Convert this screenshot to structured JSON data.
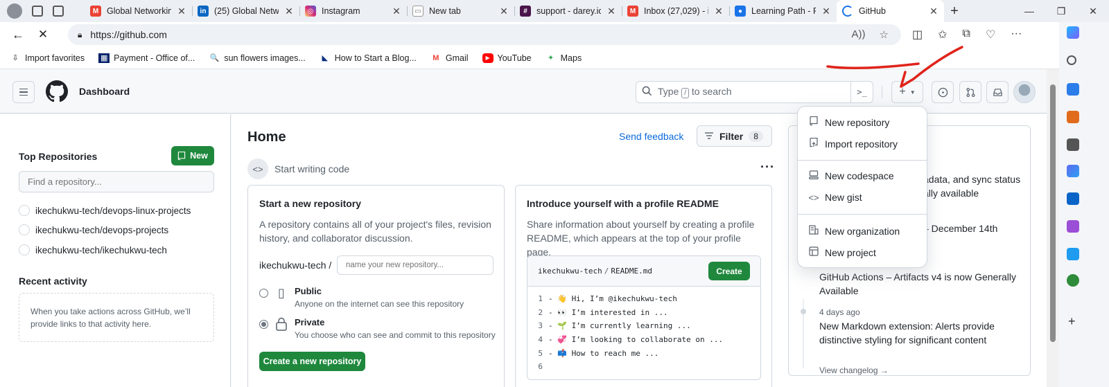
{
  "browser": {
    "tabs": [
      {
        "title": "Global Networkin",
        "fav": "M",
        "color": "#ea4335"
      },
      {
        "title": "(25) Global Netw",
        "fav": "in",
        "color": "#0a66c2"
      },
      {
        "title": "Instagram",
        "fav": "◎",
        "color": "#d6249f"
      },
      {
        "title": "New tab",
        "fav": "▭",
        "color": "#9aa0a6"
      },
      {
        "title": "support - darey.io",
        "fav": "#",
        "color": "#4a154b"
      },
      {
        "title": "Inbox (27,029) - i",
        "fav": "M",
        "color": "#ea4335"
      },
      {
        "title": "Learning Path - P",
        "fav": "●",
        "color": "#1a73e8"
      },
      {
        "title": "GitHub",
        "fav": "◐",
        "color": "#24292f"
      }
    ],
    "url": "https://github.com",
    "bookmarks": [
      {
        "label": "Import favorites",
        "icon": "⇩"
      },
      {
        "label": "Payment - Office of...",
        "icon": "▦"
      },
      {
        "label": "sun flowers images...",
        "icon": "🔍"
      },
      {
        "label": "How to Start a Blog...",
        "icon": "◣"
      },
      {
        "label": "Gmail",
        "icon": "M"
      },
      {
        "label": "YouTube",
        "icon": "▶"
      },
      {
        "label": "Maps",
        "icon": "✦"
      }
    ]
  },
  "header": {
    "title": "Dashboard",
    "search_type": "Type",
    "search_key": "/",
    "search_rest": "to search"
  },
  "sidebar": {
    "top_repositories": "Top Repositories",
    "new_button": "New",
    "find_placeholder": "Find a repository...",
    "repos": [
      "ikechukwu-tech/devops-linux-projects",
      "ikechukwu-tech/devops-projects",
      "ikechukwu-tech/ikechukwu-tech"
    ],
    "recent_activity": "Recent activity",
    "recent_empty_line1": "When you take actions across GitHub, we’ll",
    "recent_empty_line2": "provide links to that activity here."
  },
  "main": {
    "home": "Home",
    "send_feedback": "Send feedback",
    "filter": "Filter",
    "filter_count": "8",
    "start_writing": "Start writing code",
    "new_repo_card": {
      "title": "Start a new repository",
      "description": "A repository contains all of your project's files, revision history, and collaborator discussion.",
      "owner": "ikechukwu-tech /",
      "name_placeholder": "name your new repository...",
      "public_title": "Public",
      "public_desc": "Anyone on the internet can see this repository",
      "private_title": "Private",
      "private_desc": "You choose who can see and commit to this repository",
      "create_button": "Create a new repository"
    },
    "readme_card": {
      "title": "Introduce yourself with a profile README",
      "description": "Share information about yourself by creating a profile README, which appears at the top of your profile page.",
      "file_owner": "ikechukwu-tech",
      "file_name": "README.md",
      "create_button": "Create",
      "lines": [
        {
          "n": "1",
          "text": "- 👋 Hi, I’m @ikechukwu-tech"
        },
        {
          "n": "2",
          "text": "- 👀 I’m interested in ..."
        },
        {
          "n": "3",
          "text": "- 🌱 I’m currently learning ..."
        },
        {
          "n": "4",
          "text": "- 💞️ I’m looking to collaborate on ..."
        },
        {
          "n": "5",
          "text": "- 📫 How to reach me ..."
        },
        {
          "n": "6",
          "text": ""
        }
      ]
    },
    "changelog": {
      "partial1a": "adata, and sync status",
      "partial1b": "ally available",
      "partial2": "– December 14th",
      "item3": "GitHub Actions – Artifacts v4 is now Generally Available",
      "item4_date": "4 days ago",
      "item4": "New Markdown extension: Alerts provide distinctive styling for significant content",
      "view_changelog": "View changelog →"
    }
  },
  "dropdown": {
    "items": [
      {
        "label": "New repository",
        "icon": "repo-icon"
      },
      {
        "label": "Import repository",
        "icon": "import-icon"
      },
      {
        "label": "New codespace",
        "icon": "codespace-icon"
      },
      {
        "label": "New gist",
        "icon": "code-icon"
      },
      {
        "label": "New organization",
        "icon": "organization-icon"
      },
      {
        "label": "New project",
        "icon": "project-icon"
      }
    ]
  },
  "colors": {
    "primary_green": "#1f883d",
    "link_blue": "#0969da",
    "annotation_red": "#e0241b"
  }
}
